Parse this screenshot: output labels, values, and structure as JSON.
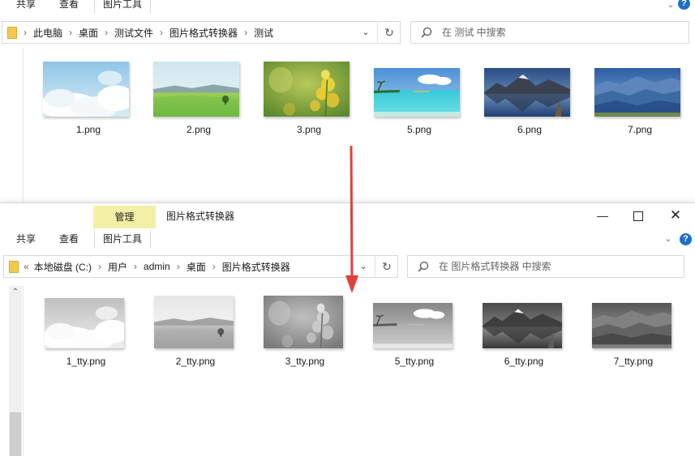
{
  "win1": {
    "ribbon": {
      "share": "共享",
      "view": "查看",
      "picture_tools": "图片工具"
    },
    "address": {
      "crumbs": [
        "此电脑",
        "桌面",
        "测试文件",
        "图片格式转换器",
        "测试"
      ]
    },
    "search": {
      "placeholder": "在 测试 中搜索"
    },
    "files": [
      "1.png",
      "2.png",
      "3.png",
      "5.png",
      "6.png",
      "7.png"
    ]
  },
  "win2": {
    "title": "图片格式转换器",
    "ribbon": {
      "manage": "管理",
      "share": "共享",
      "view": "查看",
      "picture_tools": "图片工具"
    },
    "address": {
      "overflow": "«",
      "crumbs": [
        "本地磁盘 (C:)",
        "用户",
        "admin",
        "桌面",
        "图片格式转换器"
      ]
    },
    "search": {
      "placeholder": "在 图片格式转换器 中搜索"
    },
    "files": [
      "1_tty.png",
      "2_tty.png",
      "3_tty.png",
      "5_tty.png",
      "6_tty.png",
      "7_tty.png"
    ]
  },
  "colors": {
    "arrow": "#e0413a",
    "manage_tab": "#f3f0a6",
    "help": "#1f6fc8",
    "folder": "#f6c94c"
  },
  "icons": [
    "chevron-down-icon",
    "help-icon",
    "folder-icon",
    "refresh-icon",
    "search-icon",
    "minimize-icon",
    "maximize-icon",
    "close-icon"
  ]
}
